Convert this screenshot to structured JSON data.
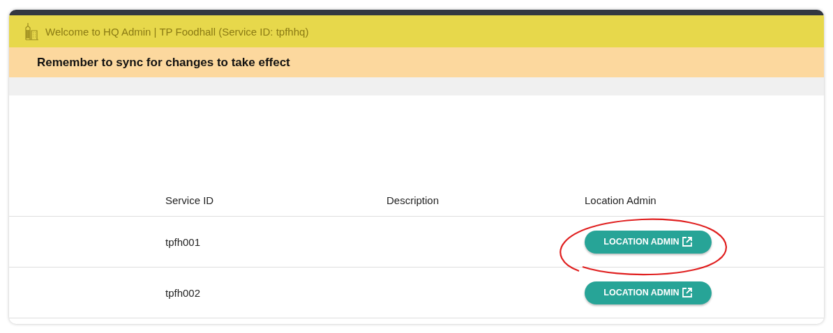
{
  "header": {
    "title": "Welcome to HQ Admin | TP Foodhall (Service ID: tpfhhq)"
  },
  "notice": "Remember to sync for changes to take effect",
  "table": {
    "columns": [
      "Service ID",
      "Description",
      "Location Admin"
    ],
    "rows": [
      {
        "service_id": "tpfh001",
        "button": "LOCATION ADMIN",
        "annotated": true
      },
      {
        "service_id": "tpfh002",
        "button": "LOCATION ADMIN",
        "annotated": false
      }
    ]
  }
}
